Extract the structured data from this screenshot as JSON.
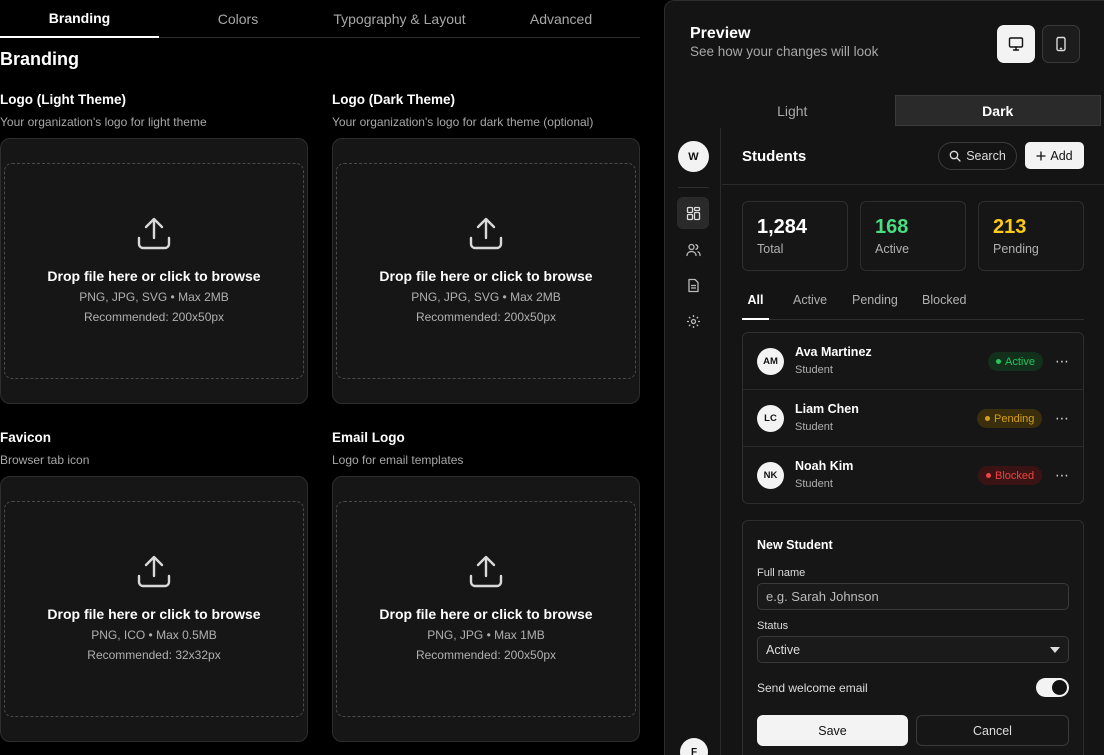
{
  "tabs": [
    {
      "label": "Branding",
      "active": true
    },
    {
      "label": "Colors",
      "active": false
    },
    {
      "label": "Typography & Layout",
      "active": false
    },
    {
      "label": "Advanced",
      "active": false
    }
  ],
  "section_title": "Branding",
  "uploads": [
    {
      "label": "Logo (Light Theme)",
      "help": "Your organization's logo for light theme",
      "drop": "Drop file here or click to browse",
      "formats": "PNG, JPG, SVG • Max 2MB",
      "recommended": "Recommended: 200x50px"
    },
    {
      "label": "Logo (Dark Theme)",
      "help": "Your organization's logo for dark theme (optional)",
      "drop": "Drop file here or click to browse",
      "formats": "PNG, JPG, SVG • Max 2MB",
      "recommended": "Recommended: 200x50px"
    },
    {
      "label": "Favicon",
      "help": "Browser tab icon",
      "drop": "Drop file here or click to browse",
      "formats": "PNG, ICO • Max 0.5MB",
      "recommended": "Recommended: 32x32px"
    },
    {
      "label": "Email Logo",
      "help": "Logo for email templates",
      "drop": "Drop file here or click to browse",
      "formats": "PNG, JPG • Max 1MB",
      "recommended": "Recommended: 200x50px"
    }
  ],
  "preview": {
    "title": "Preview",
    "subtitle": "See how your changes will look",
    "device_icons": [
      "desktop-icon",
      "mobile-icon"
    ],
    "modes": [
      {
        "label": "Light",
        "active": false
      },
      {
        "label": "Dark",
        "active": true
      }
    ]
  },
  "mini_app": {
    "org_avatar": "W",
    "user_avatar": "F",
    "nav_icons": [
      "dashboard-icon",
      "users-icon",
      "document-icon",
      "settings-icon"
    ],
    "title": "Students",
    "search_label": "Search",
    "add_label": "Add",
    "stats": [
      {
        "value": "1,284",
        "label": "Total",
        "color": "#ffffff"
      },
      {
        "value": "168",
        "label": "Active",
        "color": "#4ade80"
      },
      {
        "value": "213",
        "label": "Pending",
        "color": "#facc15"
      }
    ],
    "filters": [
      {
        "label": "All",
        "active": true
      },
      {
        "label": "Active",
        "active": false
      },
      {
        "label": "Pending",
        "active": false
      },
      {
        "label": "Blocked",
        "active": false
      }
    ],
    "students": [
      {
        "initials": "AM",
        "name": "Ava Martinez",
        "role": "Student",
        "status": "Active",
        "status_color": "#22c55e",
        "status_bg": "#13301d"
      },
      {
        "initials": "LC",
        "name": "Liam Chen",
        "role": "Student",
        "status": "Pending",
        "status_color": "#d4a017",
        "status_bg": "#3a2e0c"
      },
      {
        "initials": "NK",
        "name": "Noah Kim",
        "role": "Student",
        "status": "Blocked",
        "status_color": "#ef4444",
        "status_bg": "#3a1414"
      }
    ],
    "form": {
      "title": "New Student",
      "name_label": "Full name",
      "name_placeholder": "e.g. Sarah Johnson",
      "status_label": "Status",
      "status_value": "Active",
      "toggle_label": "Send welcome email",
      "toggle_on": true,
      "save_label": "Save",
      "cancel_label": "Cancel"
    }
  }
}
